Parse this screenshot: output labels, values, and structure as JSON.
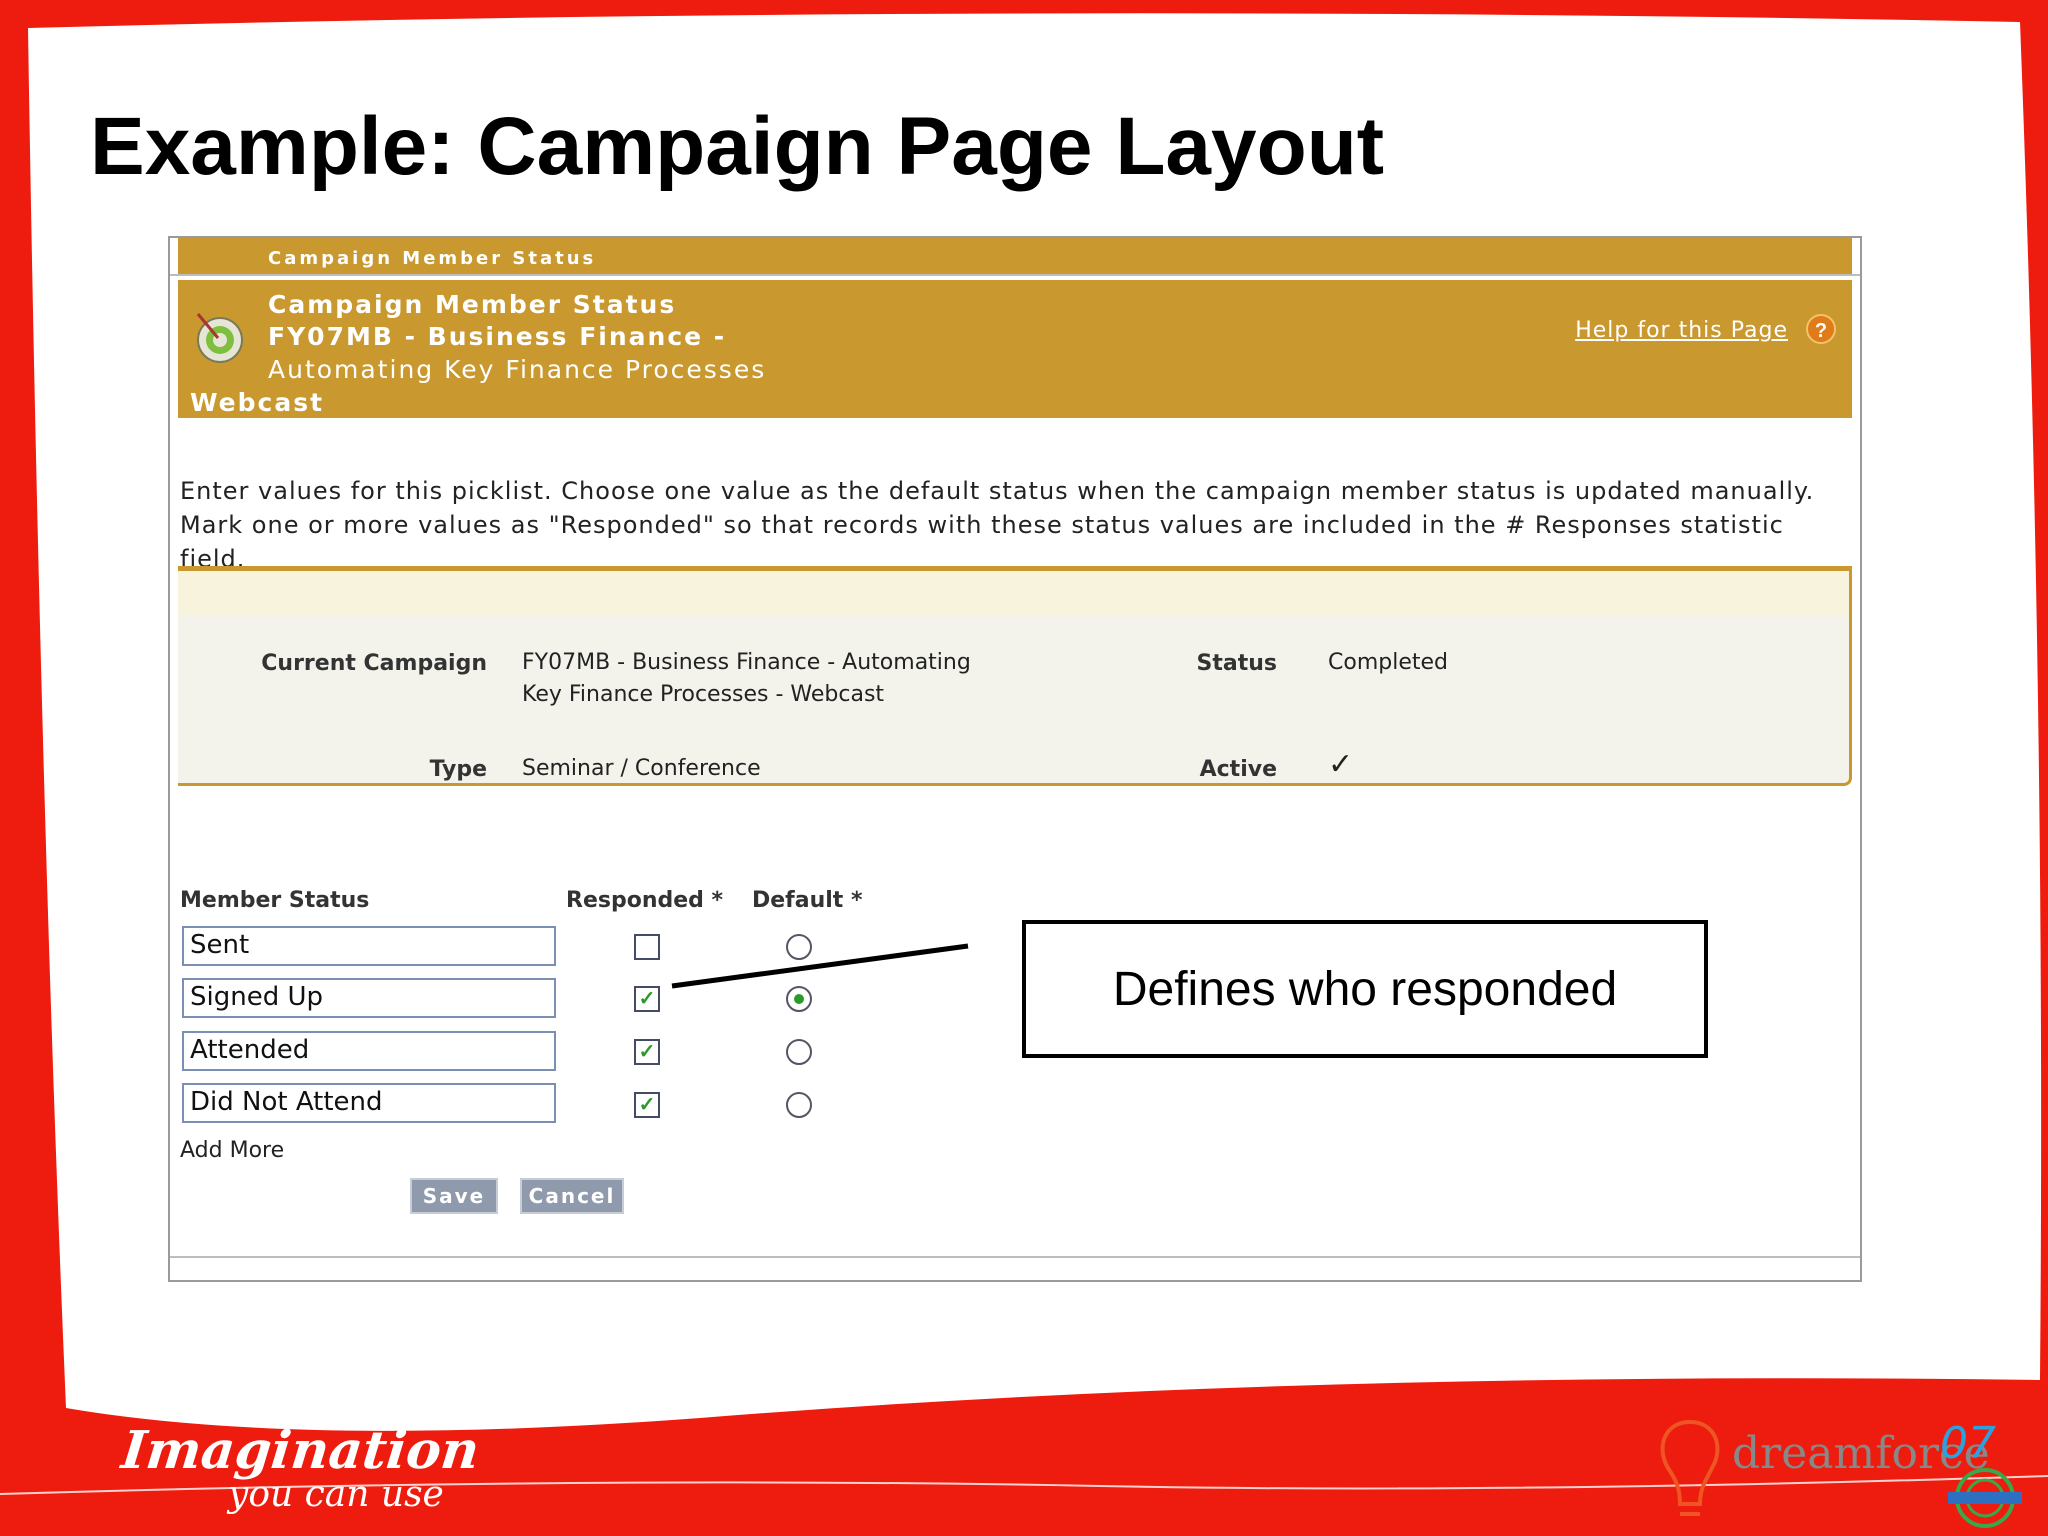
{
  "slide": {
    "title": "Example:  Campaign Page Layout",
    "callout": "Defines who responded"
  },
  "ghost_header": {
    "title": "Campaign Member Status"
  },
  "page_header": {
    "line1": "Campaign Member Status",
    "line2": "FY07MB - Business Finance -",
    "line3": "Automating Key Finance Processes",
    "line4": "Webcast",
    "help_link": "Help for this Page",
    "help_icon": "?"
  },
  "instructions": "Enter values for this picklist. Choose one value as the default status when the campaign member status is updated manually. Mark one or more values as \"Responded\" so that records with these status values are included in the # Responses statistic field.",
  "campaign_details": {
    "current_campaign_label": "Current Campaign",
    "current_campaign_value": "FY07MB - Business Finance - Automating Key Finance Processes - Webcast",
    "status_label": "Status",
    "status_value": "Completed",
    "type_label": "Type",
    "type_value": "Seminar / Conference",
    "active_label": "Active",
    "active_value": "✓"
  },
  "member_status_table": {
    "headers": {
      "member_status": "Member Status",
      "responded": "Responded *",
      "default": "Default *"
    },
    "rows": [
      {
        "status": "Sent",
        "responded": false,
        "default": false
      },
      {
        "status": "Signed Up",
        "responded": true,
        "default": true
      },
      {
        "status": "Attended",
        "responded": true,
        "default": false
      },
      {
        "status": "Did Not Attend",
        "responded": true,
        "default": false
      }
    ],
    "add_more": "Add More",
    "save_label": "Save",
    "cancel_label": "Cancel"
  },
  "logos": {
    "imagination": "Imagination",
    "imagination_sub": "you can use",
    "dreamforce": "dreamforce",
    "dreamforce_year": "07"
  },
  "colors": {
    "slide_red": "#ee1c0e",
    "header_gold": "#c9982f",
    "check_green": "#2a9a2a"
  }
}
